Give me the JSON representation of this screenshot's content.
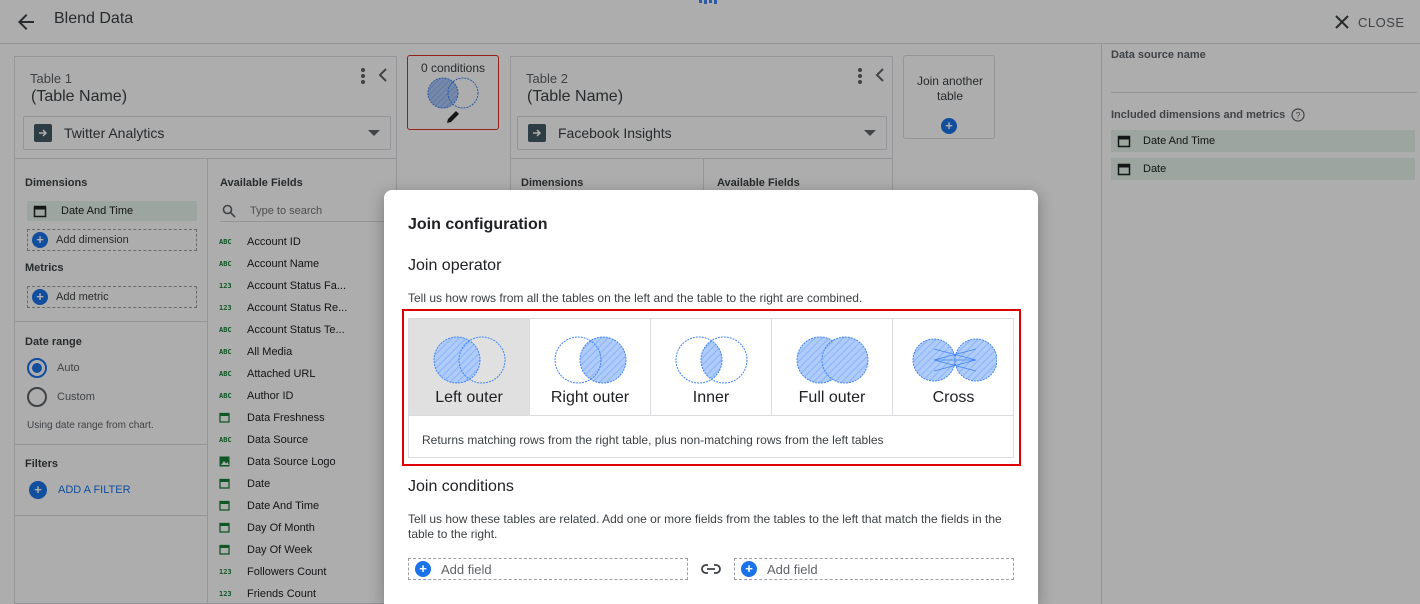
{
  "header": {
    "title": "Blend Data",
    "close_label": "CLOSE"
  },
  "table1": {
    "label": "Table 1",
    "name": "(Table Name)",
    "source": "Twitter Analytics",
    "dimensions_label": "Dimensions",
    "dimensions": [
      "Date And Time"
    ],
    "add_dimension": "Add dimension",
    "metrics_label": "Metrics",
    "add_metric": "Add metric",
    "date_range_label": "Date range",
    "date_options": [
      "Auto",
      "Custom"
    ],
    "date_hint": "Using date range from chart.",
    "filters_label": "Filters",
    "add_filter": "ADD A FILTER",
    "available_label": "Available Fields",
    "search_placeholder": "Type to search",
    "fields": [
      {
        "type": "ABC",
        "name": "Account ID"
      },
      {
        "type": "ABC",
        "name": "Account Name"
      },
      {
        "type": "123",
        "name": "Account Status Fa..."
      },
      {
        "type": "123",
        "name": "Account Status Re..."
      },
      {
        "type": "ABC",
        "name": "Account Status Te..."
      },
      {
        "type": "ABC",
        "name": "All Media"
      },
      {
        "type": "ABC",
        "name": "Attached URL"
      },
      {
        "type": "ABC",
        "name": "Author ID"
      },
      {
        "type": "date",
        "name": "Data Freshness"
      },
      {
        "type": "ABC",
        "name": "Data Source"
      },
      {
        "type": "image",
        "name": "Data Source Logo"
      },
      {
        "type": "date",
        "name": "Date"
      },
      {
        "type": "date",
        "name": "Date And Time"
      },
      {
        "type": "date",
        "name": "Day Of Month"
      },
      {
        "type": "date",
        "name": "Day Of Week"
      },
      {
        "type": "123",
        "name": "Followers Count"
      },
      {
        "type": "123",
        "name": "Friends Count"
      }
    ]
  },
  "conditions": {
    "label": "0 conditions"
  },
  "table2": {
    "label": "Table 2",
    "name": "(Table Name)",
    "source": "Facebook Insights",
    "dimensions_label": "Dimensions",
    "available_label": "Available Fields"
  },
  "join_another": {
    "label": "Join another table"
  },
  "right_panel": {
    "source_name_label": "Data source name",
    "included_label": "Included dimensions and metrics",
    "items": [
      "Date And Time",
      "Date"
    ]
  },
  "modal": {
    "title": "Join configuration",
    "operator_heading": "Join operator",
    "operator_desc": "Tell us how rows from all the tables on the left and the table to the right are combined.",
    "operators": [
      "Left outer",
      "Right outer",
      "Inner",
      "Full outer",
      "Cross"
    ],
    "selected_operator": "Left outer",
    "operator_explain": "Returns matching rows from the right table, plus non-matching rows from the left tables",
    "conditions_heading": "Join conditions",
    "conditions_desc": "Tell us how these tables are related. Add one or more fields from the tables to the left that match the fields in the table to the right.",
    "add_field_left": "Add field",
    "add_field_right": "Add field"
  },
  "colors": {
    "accent": "#1a73e8",
    "highlight": "#e00000",
    "chip": "#e6f4ea",
    "venn_fill": "#aecbfa"
  }
}
